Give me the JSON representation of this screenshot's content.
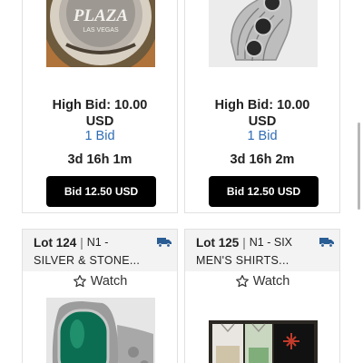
{
  "cards_top": [
    {
      "image": "plaza-las-vegas-silver-coin",
      "coin_text": "PLAZA",
      "coin_subtext": "LAS VEGAS",
      "high_bid_line1": "High Bid: 10.00",
      "high_bid_line2": "USD",
      "bid_count": "1 Bid",
      "time_left": "3d 16h 1m",
      "button": "Bid 12.50 USD"
    },
    {
      "image": "silver-onyx-ring",
      "high_bid_line1": "High Bid: 10.00",
      "high_bid_line2": "USD",
      "bid_count": "1 Bid",
      "time_left": "3d 16h 2m",
      "button": "Bid 12.50 USD"
    }
  ],
  "cards_bottom": [
    {
      "lot": "Lot 124",
      "category": "N1 -",
      "title": "SILVER & STONE...",
      "watch": "Watch",
      "image": "green-stone-silver-ring",
      "shipping_icon": "truck-icon",
      "star_icon": "star-outline-icon"
    },
    {
      "lot": "Lot 125",
      "category": "N1 - SIX",
      "title": "MEN'S SHIRTS...",
      "watch": "Watch",
      "image": "six-mens-shirts",
      "shipping_icon": "truck-icon",
      "star_icon": "star-outline-icon"
    }
  ],
  "colors": {
    "bid_count": "#2f6db5",
    "button_bg": "#000000",
    "truck": "#2a5d94",
    "header_bg": "#f3f3f3"
  }
}
